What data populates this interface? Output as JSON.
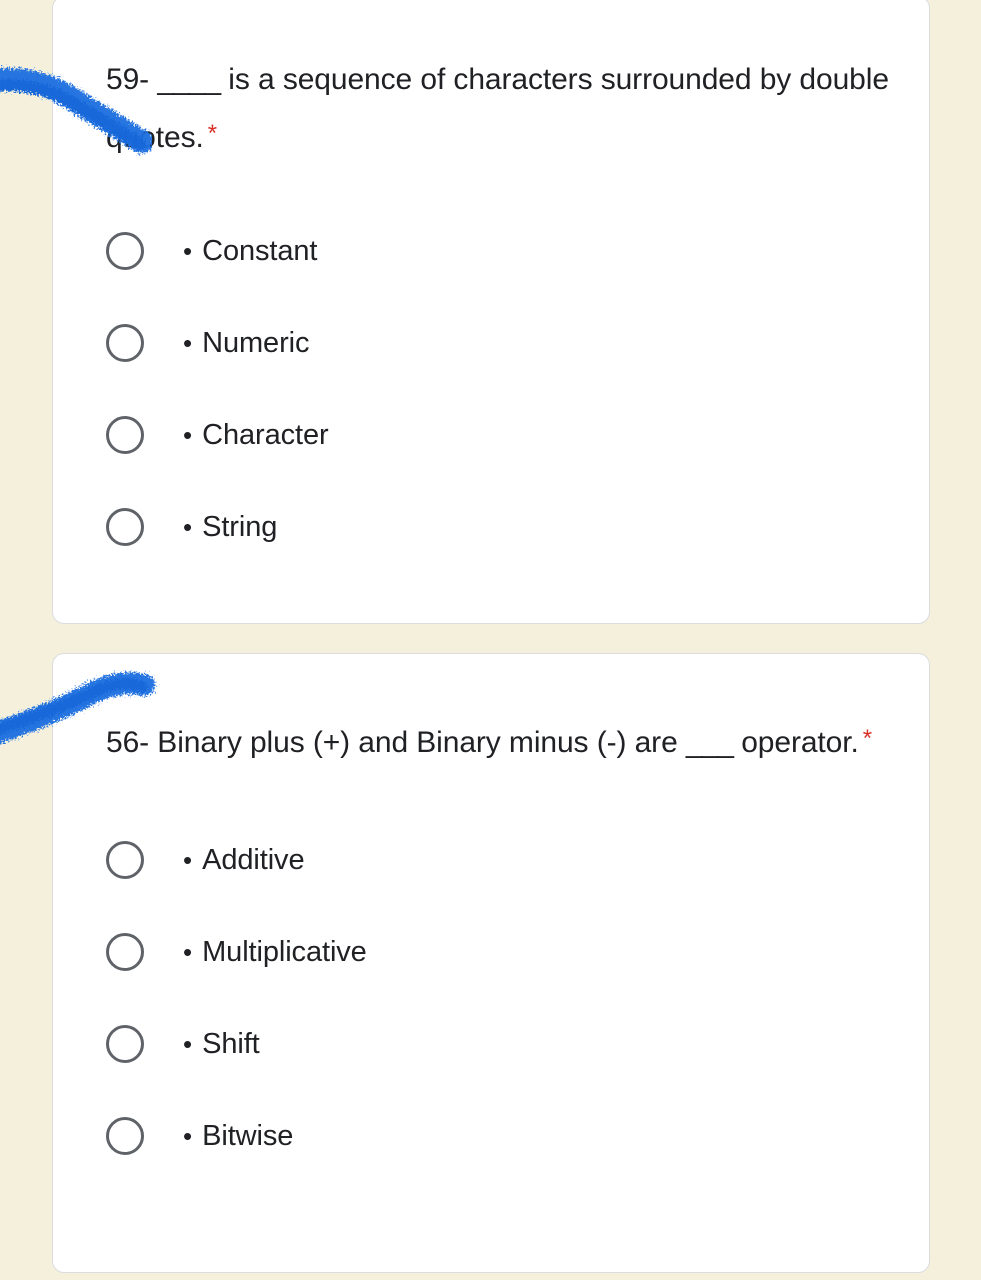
{
  "page": {
    "background_color": "#f4f0dc",
    "card_background": "#ffffff",
    "card_border_color": "#dadce0",
    "text_color": "#202124",
    "required_star_color": "#d93025",
    "radio_border_color": "#5f6368",
    "highlight_color": "#1a6fe0",
    "scrollbar_color": "#a9a494"
  },
  "questions": [
    {
      "number": "59-",
      "blank": "____",
      "text_after_blank": " is a sequence of characters surrounded by double quotes.",
      "required_marker": "*",
      "highlighted": true,
      "options": [
        {
          "bullet": "•",
          "label": "Constant",
          "selected": false
        },
        {
          "bullet": "•",
          "label": "Numeric",
          "selected": false
        },
        {
          "bullet": "•",
          "label": "Character",
          "selected": false
        },
        {
          "bullet": "•",
          "label": "String",
          "selected": false
        }
      ]
    },
    {
      "number": "56-",
      "text_before_blank": " Binary plus (+) and Binary minus (-) are ",
      "blank": "___",
      "text_after_blank": " operator.",
      "required_marker": "*",
      "highlighted": true,
      "options": [
        {
          "bullet": "•",
          "label": "Additive",
          "selected": false
        },
        {
          "bullet": "•",
          "label": "Multiplicative",
          "selected": false
        },
        {
          "bullet": "•",
          "label": "Shift",
          "selected": false
        },
        {
          "bullet": "•",
          "label": "Bitwise",
          "selected": false
        }
      ]
    }
  ]
}
